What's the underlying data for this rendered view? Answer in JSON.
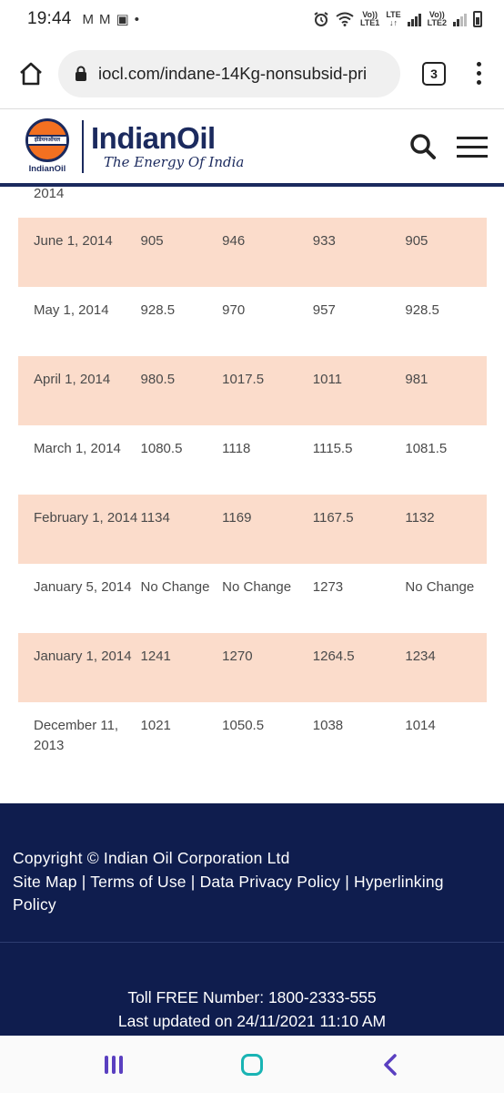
{
  "status_bar": {
    "time": "19:44",
    "left_icons": [
      "M",
      "M",
      "▣",
      "•"
    ],
    "net1": "LTE1",
    "net2": "LTE2",
    "lte": "LTE",
    "volte": "Vo))"
  },
  "browser": {
    "url": "iocl.com/indane-14Kg-nonsubsid-pri",
    "tab_count": "3"
  },
  "site_header": {
    "logo_small": "IndianOil",
    "logo_band": "इंडियनऑयल",
    "logo_name": "IndianOil",
    "tagline": "The Energy Of India"
  },
  "table": {
    "partial_row": {
      "date": "2014"
    },
    "rows": [
      {
        "date": "June 1, 2014",
        "c1": "905",
        "c2": "946",
        "c3": "933",
        "c4": "905",
        "shaded": true
      },
      {
        "date": "May 1, 2014",
        "c1": "928.5",
        "c2": "970",
        "c3": "957",
        "c4": "928.5",
        "shaded": false
      },
      {
        "date": "April 1, 2014",
        "c1": "980.5",
        "c2": "1017.5",
        "c3": "1011",
        "c4": "981",
        "shaded": true
      },
      {
        "date": "March 1, 2014",
        "c1": "1080.5",
        "c2": "1118",
        "c3": "1115.5",
        "c4": "1081.5",
        "shaded": false
      },
      {
        "date": "February 1, 2014",
        "c1": "1134",
        "c2": "1169",
        "c3": "1167.5",
        "c4": "1132",
        "shaded": true
      },
      {
        "date": "January 5, 2014",
        "c1": "No Change",
        "c2": "No Change",
        "c3": "1273",
        "c4": "No Change",
        "shaded": false
      },
      {
        "date": "January 1, 2014",
        "c1": "1241",
        "c2": "1270",
        "c3": "1264.5",
        "c4": "1234",
        "shaded": true
      },
      {
        "date": "December 11, 2013",
        "c1": "1021",
        "c2": "1050.5",
        "c3": "1038",
        "c4": "1014",
        "shaded": false
      }
    ]
  },
  "footer": {
    "copyright": "Copyright © Indian Oil Corporation Ltd",
    "links": [
      "Site Map",
      "Terms of Use",
      "Data Privacy Policy",
      "Hyperlinking Policy"
    ],
    "separator": " | ",
    "toll_free": "Toll FREE Number: 1800-2333-555",
    "last_updated": "Last updated on 24/11/2021 11:10 AM"
  },
  "colors": {
    "brand_navy": "#1b2a5e",
    "brand_orange": "#f37021",
    "row_shade": "#fbdccb",
    "footer_bg": "#0f1d4e"
  }
}
